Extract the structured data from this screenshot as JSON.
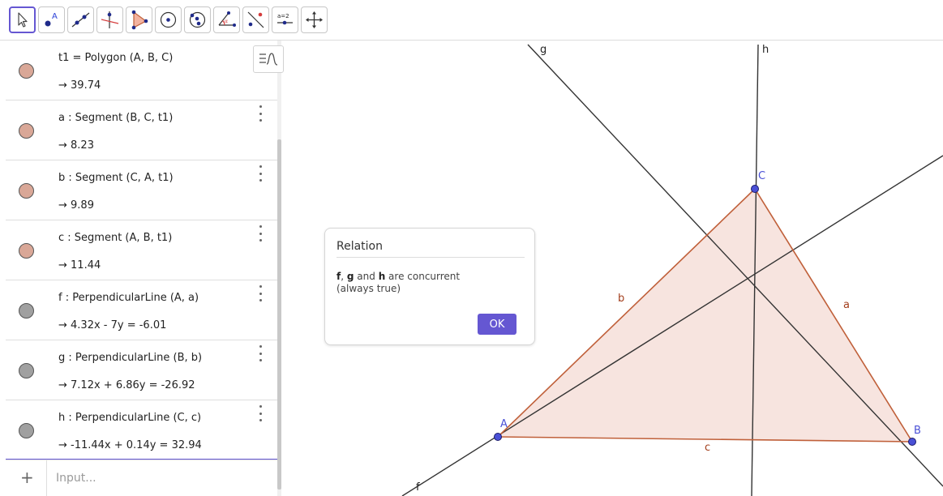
{
  "toolbar": {
    "tools": [
      {
        "name": "move-tool",
        "active": true
      },
      {
        "name": "point-tool"
      },
      {
        "name": "line-tool"
      },
      {
        "name": "perpendicular-line-tool"
      },
      {
        "name": "polygon-tool"
      },
      {
        "name": "circle-center-point-tool"
      },
      {
        "name": "circle-three-points-tool"
      },
      {
        "name": "angle-tool"
      },
      {
        "name": "reflect-tool"
      },
      {
        "name": "slider-tool",
        "label": "a=2"
      },
      {
        "name": "move-graphics-view-tool"
      }
    ]
  },
  "algebra": {
    "rows": [
      {
        "definition": "t1 = Polygon (A, B, C)",
        "value": "→  39.74",
        "color": "#d9a797",
        "show_menu": false
      },
      {
        "definition": "a : Segment (B, C, t1)",
        "value": "→  8.23",
        "color": "#d9a797",
        "show_menu": true
      },
      {
        "definition": "b : Segment (C, A, t1)",
        "value": "→  9.89",
        "color": "#d9a797",
        "show_menu": true
      },
      {
        "definition": "c : Segment (A, B, t1)",
        "value": "→  11.44",
        "color": "#d9a797",
        "show_menu": true
      },
      {
        "definition": "f : PerpendicularLine (A, a)",
        "value": "→  4.32x - 7y = -6.01",
        "color": "#a0a0a0",
        "show_menu": true
      },
      {
        "definition": "g : PerpendicularLine (B, b)",
        "value": "→  7.12x + 6.86y = -26.92",
        "color": "#a0a0a0",
        "show_menu": true
      },
      {
        "definition": "h : PerpendicularLine (C, c)",
        "value": "→  -11.44x + 0.14y = 32.94",
        "color": "#a0a0a0",
        "show_menu": true
      }
    ],
    "input_placeholder": "Input...",
    "plus_symbol": "+"
  },
  "graphics": {
    "labels": {
      "g": "g",
      "h": "h",
      "f": "f",
      "a": "a",
      "b": "b",
      "c": "c",
      "A": "A",
      "B": "B",
      "C": "C"
    },
    "colors": {
      "point": "#4a50d6",
      "segment": "#c0603a",
      "polygon_fill": "#f7e4df",
      "line": "#333333"
    }
  },
  "dialog": {
    "title": "Relation",
    "name1": "f",
    "sep1": ", ",
    "name2": "g",
    "sep2": " and ",
    "name3": "h",
    "message_rest": " are concurrent",
    "note": "(always true)",
    "ok_label": "OK",
    "accent": "#6557d2"
  }
}
